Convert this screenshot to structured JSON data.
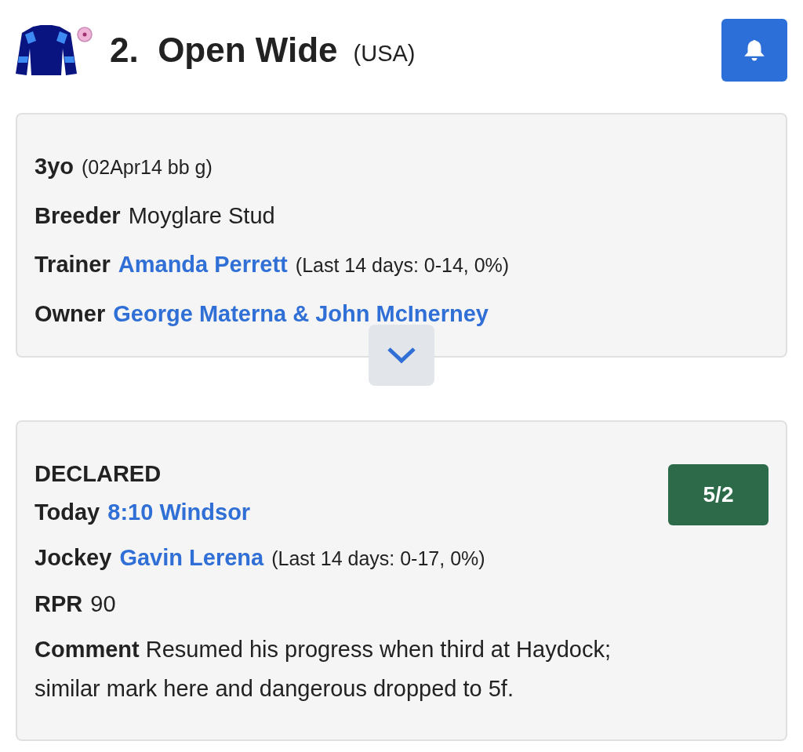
{
  "header": {
    "number": "2.",
    "name": "Open Wide",
    "country": "(USA)"
  },
  "details": {
    "rows": [
      {
        "label": "3yo",
        "note": "(02Apr14 bb g)"
      },
      {
        "label": "Breeder",
        "value": "Moyglare Stud",
        "kind": "text"
      },
      {
        "label": "Trainer",
        "value": "Amanda Perrett",
        "kind": "link",
        "note": "(Last 14 days: 0-14, 0%)"
      },
      {
        "label": "Owner",
        "value": "George Materna & John McInerney",
        "kind": "link"
      }
    ],
    "expanded": false
  },
  "entry": {
    "status": "DECLARED",
    "odds": "5/2",
    "rows": [
      {
        "label": "Today",
        "value": "8:10 Windsor",
        "kind": "link"
      },
      {
        "label": "Jockey",
        "value": "Gavin Lerena",
        "kind": "link",
        "note": "(Last 14 days: 0-17, 0%)"
      },
      {
        "label": "RPR",
        "value": "90",
        "kind": "text"
      },
      {
        "label": "Comment",
        "value": "Resumed his progress when third at Haydock; similar mark here and dangerous dropped to 5f.",
        "kind": "paragraph"
      }
    ]
  }
}
